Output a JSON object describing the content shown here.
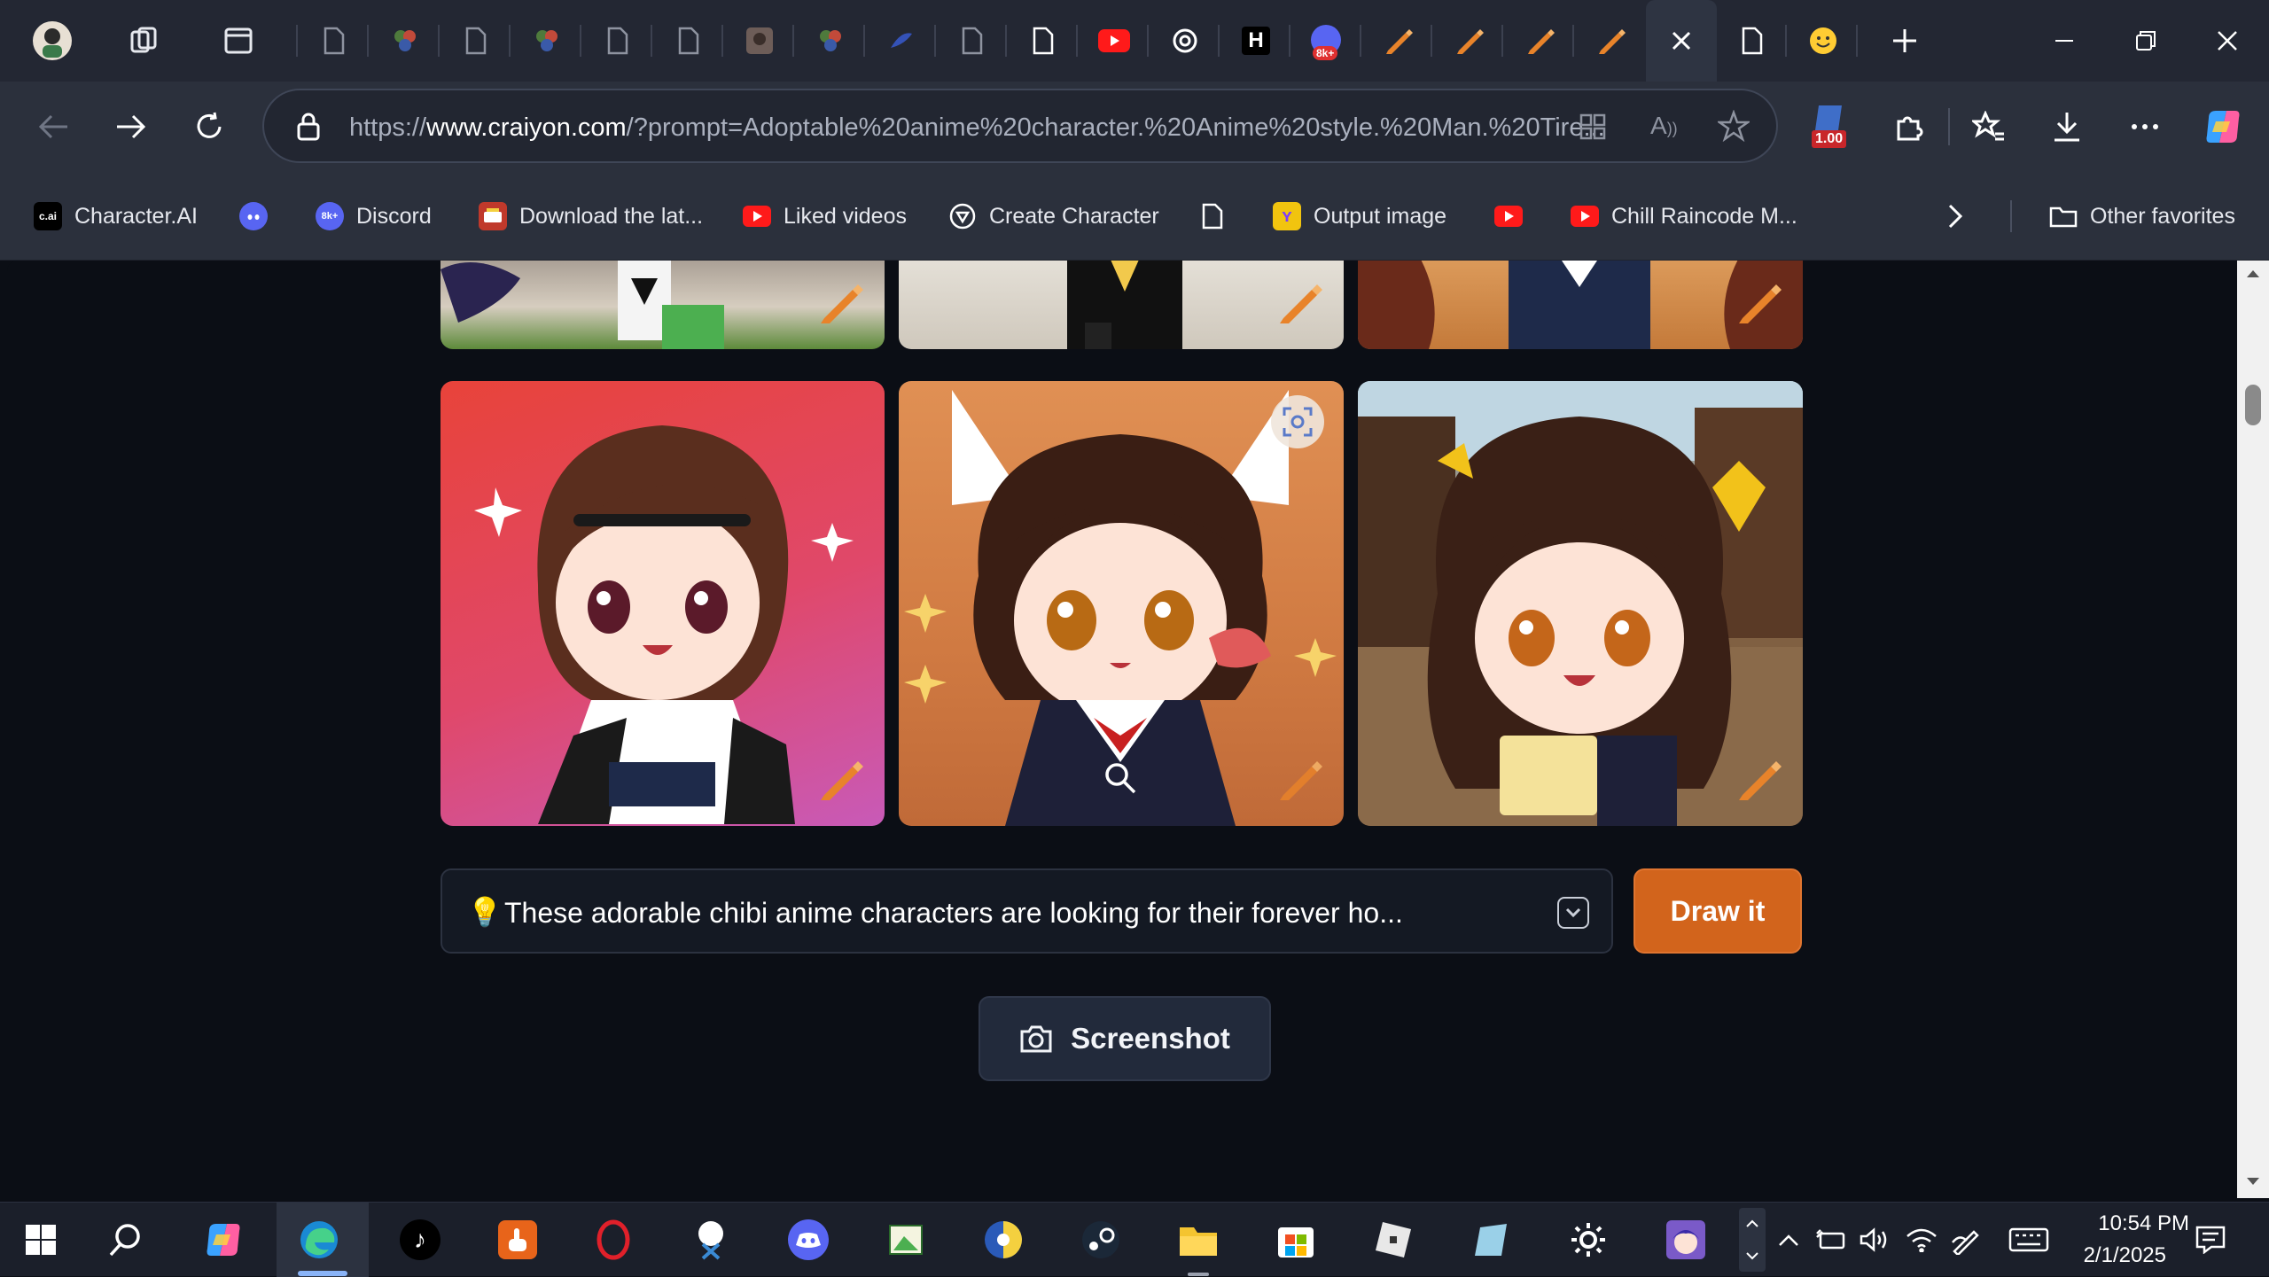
{
  "browser": {
    "url_host_prefix": "https://",
    "url_host": "www.craiyon.com",
    "url_rest": "/?prompt=Adoptable%20anime%20character.%20Anime%20style.%20Man.%20Tire...",
    "zoom_badge": "1.00",
    "tab_badge": "8k+"
  },
  "bookmarks": [
    {
      "label": "Character.AI",
      "icon": "c.ai"
    },
    {
      "label": "",
      "icon": "discord"
    },
    {
      "label": "Discord",
      "icon": "8k+"
    },
    {
      "label": "Download the lat...",
      "icon": "download"
    },
    {
      "label": "Liked videos",
      "icon": "youtube"
    },
    {
      "label": "Create Character",
      "icon": "character"
    },
    {
      "label": "",
      "icon": "page"
    },
    {
      "label": "Output image",
      "icon": "output"
    },
    {
      "label": "",
      "icon": "youtube"
    },
    {
      "label": "Chill Raincode M...",
      "icon": "youtube"
    }
  ],
  "other_favorites": "Other favorites",
  "page": {
    "prompt_icon": "💡",
    "prompt_text": "These adorable chibi anime characters are looking for their forever ho...",
    "draw_button": "Draw it",
    "screenshot_button": "Screenshot"
  },
  "taskbar": {
    "time": "10:54 PM",
    "date": "2/1/2025"
  },
  "colors": {
    "accent_orange": "#d2641c",
    "page_bg": "#0b0e15",
    "chrome_bg": "#2b303c"
  }
}
